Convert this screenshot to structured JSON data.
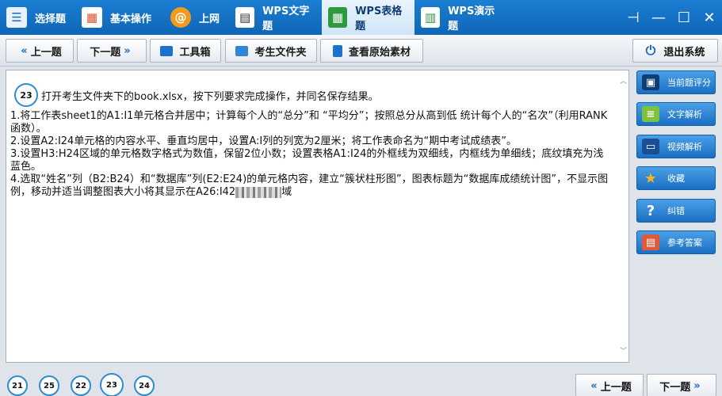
{
  "topbar": {
    "tabs": [
      {
        "label": "选择题",
        "icon": "list-icon"
      },
      {
        "label": "基本操作",
        "icon": "windows-icon"
      },
      {
        "label": "上网",
        "icon": "at-icon"
      },
      {
        "label": "WPS文字题",
        "icon": "document-icon"
      },
      {
        "label": "WPS表格题",
        "icon": "spreadsheet-icon",
        "active": true
      },
      {
        "label": "WPS演示题",
        "icon": "presentation-icon"
      }
    ],
    "window_controls": [
      "⊣",
      "—",
      "☐",
      "✕"
    ]
  },
  "toolbar": {
    "prev_label": "上一题",
    "next_label": "下一题",
    "toolbox_label": "工具箱",
    "folder_label": "考生文件夹",
    "material_label": "查看原始素材",
    "exit_label": "退出系统"
  },
  "question": {
    "number": "23",
    "title": "打开考生文件夹下的book.xlsx，按下列要求完成操作，并同名保存结果。",
    "item1": "1.将工作表sheet1的A1:I1单元格合并居中；计算每个人的“总分”和 “平均分”；按照总分从高到低 统计每个人的“名次”（利用RANK函数）。",
    "item2": "2.设置A2:I24单元格的内容水平、垂直均居中，设置A:I列的列宽为2厘米；将工作表命名为“期中考试成绩表”。",
    "item3": "3.设置H3:H24区域的单元格数字格式为数值，保留2位小数；设置表格A1:I24的外框线为双细线，内框线为单细线；底纹填充为浅蓝色。",
    "item4_a": "4.选取“姓名”列（B2:B24）和“数据库”列(E2:E24)的单元格内容，建立“簇状柱形图”，图表标题为“数据库成绩统计图”，不显示图例，移动并适当调整图表大小将其显示在A26:I42",
    "item4_b": "域"
  },
  "sidebar": {
    "buttons": [
      {
        "label": "当前题评分",
        "icon": "save-icon"
      },
      {
        "label": "文字解析",
        "icon": "text-icon"
      },
      {
        "label": "视频解析",
        "icon": "video-icon"
      },
      {
        "label": "收藏",
        "icon": "star-icon"
      },
      {
        "label": "纠错",
        "icon": "question-icon"
      },
      {
        "label": "参考答案",
        "icon": "answer-icon"
      }
    ]
  },
  "bottom": {
    "question_numbers": [
      "21",
      "25",
      "22",
      "23",
      "24"
    ],
    "current": "23",
    "prev_label": "上一题",
    "next_label": "下一题"
  }
}
